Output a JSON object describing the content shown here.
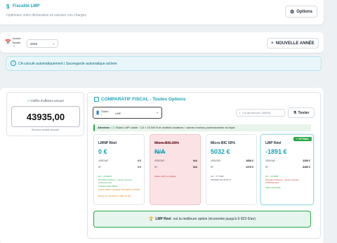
{
  "header": {
    "title": "Fiscalité LMP",
    "subtitle": "Optimisez votre déclaration et calculez vos charges",
    "options_label": "Options"
  },
  "year": {
    "label_line1": "Année",
    "label_line2": "fiscale",
    "label_line3": "*",
    "selected": "2026",
    "new_year_label": "NOUVELLE ANNÉE"
  },
  "autosave": {
    "text": "CA calculé automatiquement | Sauvegarde automatique activée"
  },
  "ca": {
    "label": "Chiffre d'affaires annuel",
    "value": "43935,00",
    "hint": "Revenus locatifs annuels"
  },
  "comparatif": {
    "title": "COMPARATIF FISCAL - Toutes Options",
    "statut_label1": "Statut",
    "statut_label2": "*",
    "statut_value": "LMP",
    "test_placeholder": "CA de test (ex: 20000)",
    "tester_label": "Tester",
    "attention_prefix": "Attention :",
    "attention_text": "Statut LMP valide : CA > 23 000 € et recettes locatives > autres revenus professionnels du foyer"
  },
  "regimes": [
    {
      "name": "LMNP Réel",
      "amount": "0 €",
      "row1_label": "URSSAF :",
      "row1_value": "0 €",
      "row2_label": "IR :",
      "row2_value": "0 €",
      "notes": [
        "CA > 23 000 €",
        "Recettes locatives > autres revenus professionnels",
        "Charges déductibles",
        "Déficit LMNP imputable (150 000 € en 2026)",
        "Report sur bénéfices LMNP 10 ans"
      ]
    },
    {
      "name": "Micro-BIC 30%",
      "amount": "N/A",
      "row1_label": "URSSAF :",
      "row1_value": "N/A",
      "row2_label": "IR :",
      "row2_value": "N/A",
      "notes": [
        "Statut LMP non éligible"
      ]
    },
    {
      "name": "Micro-BIC 50%",
      "amount": "5032 €",
      "row1_label": "URSSAF :",
      "row1_value": "2656 €",
      "row2_label": "IR :",
      "row2_value": "2376 €",
      "notes": [
        "CA < 77 700€",
        "URSSAF 6% IR 50 %"
      ]
    },
    {
      "name": "LMP Réel",
      "amount": "-1891 €",
      "badge": "✓ OPTIMAL",
      "row1_label": "URSSAF :",
      "row1_value": "3398 €",
      "row2_label": "IR :",
      "row2_value": "-5289 €",
      "notes": [
        "CA > 23 000€",
        "Recettes locatives > autres revenus professionnels",
        "Statut obtenable"
      ]
    }
  ],
  "best": {
    "label": "LMP Réel",
    "text": "est la meilleure option (économie jusqu'à 6 923 €/an)"
  },
  "colors": {
    "accent": "#17a2b8",
    "success": "#28a745",
    "danger_bg": "#fbe3e5"
  }
}
